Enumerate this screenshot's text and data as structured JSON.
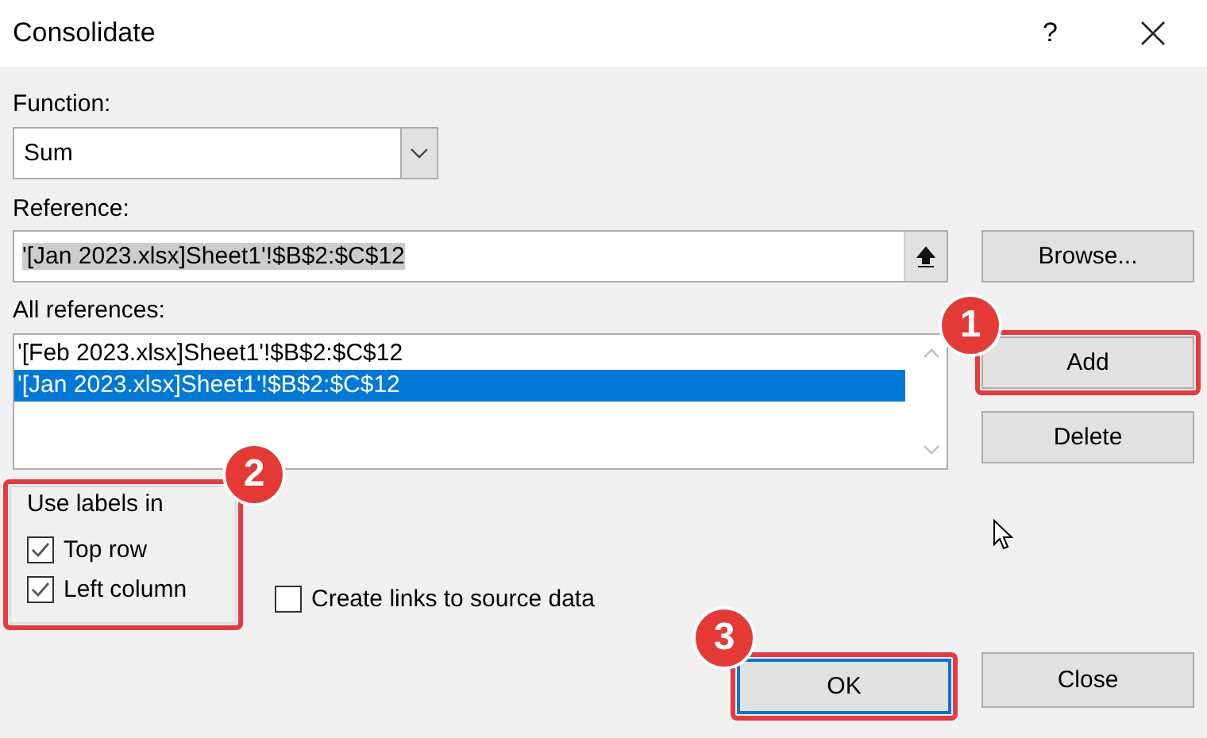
{
  "window": {
    "title": "Consolidate",
    "help": "?"
  },
  "function": {
    "label": "Function:",
    "value": "Sum"
  },
  "reference": {
    "label": "Reference:",
    "value": "'[Jan 2023.xlsx]Sheet1'!$B$2:$C$12",
    "text_selected": true
  },
  "all_references": {
    "label": "All references:",
    "items": [
      {
        "text": "'[Feb 2023.xlsx]Sheet1'!$B$2:$C$12",
        "selected": false
      },
      {
        "text": "'[Jan 2023.xlsx]Sheet1'!$B$2:$C$12",
        "selected": true
      }
    ]
  },
  "side_buttons": [
    {
      "label": "Browse..."
    },
    {
      "label": "Add",
      "callout": "1"
    },
    {
      "label": "Delete"
    }
  ],
  "label_group": {
    "title": "Use labels in",
    "callout": "2",
    "options": [
      {
        "label": "Top row",
        "checked": true
      },
      {
        "label": "Left column",
        "checked": true
      }
    ]
  },
  "create_links": {
    "label": "Create links to source data",
    "checked": false
  },
  "footer_buttons": [
    {
      "label": "OK",
      "default": true,
      "callout": "3"
    },
    {
      "label": "Close",
      "default": false
    }
  ]
}
